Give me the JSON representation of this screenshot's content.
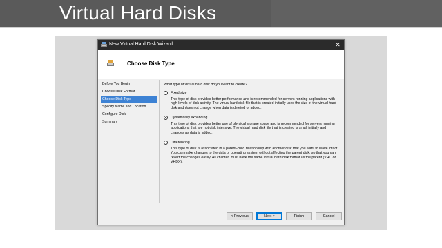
{
  "slide": {
    "title": "Virtual Hard Disks"
  },
  "window": {
    "title": "New Virtual Hard Disk Wizard",
    "close": "✕"
  },
  "header": {
    "title": "Choose Disk Type"
  },
  "sidebar": {
    "items": [
      {
        "label": "Before You Begin",
        "selected": false
      },
      {
        "label": "Choose Disk Format",
        "selected": false
      },
      {
        "label": "Choose Disk Type",
        "selected": true
      },
      {
        "label": "Specify Name and Location",
        "selected": false
      },
      {
        "label": "Configure Disk",
        "selected": false
      },
      {
        "label": "Summary",
        "selected": false
      }
    ]
  },
  "content": {
    "question": "What type of virtual hard disk do you want to create?",
    "options": [
      {
        "label": "Fixed size",
        "checked": false,
        "description": "This type of disk provides better performance and is recommended for servers running applications with high levels of disk activity. The virtual hard disk file that is created initially uses the size of the virtual hard disk and does not change when data is deleted or added."
      },
      {
        "label": "Dynamically expanding",
        "checked": true,
        "description": "This type of disk provides better use of physical storage space and is recommended for servers running applications that are not disk intensive. The virtual hard disk file that is created is small initially and changes as data is added."
      },
      {
        "label": "Differencing",
        "checked": false,
        "description": "This type of disk is associated in a parent-child relationship with another disk that you want to leave intact. You can make changes to the data or operating system without affecting the parent disk, so that you can revert the changes easily. All children must have the same virtual hard disk format as the parent (VHD or VHDX)."
      }
    ]
  },
  "buttons": {
    "previous": "< Previous",
    "next": "Next >",
    "finish": "Finish",
    "cancel": "Cancel"
  },
  "colors": {
    "selection": "#3d82d4",
    "titlebar": "#2b2b2b",
    "slide_header": "#616161"
  }
}
